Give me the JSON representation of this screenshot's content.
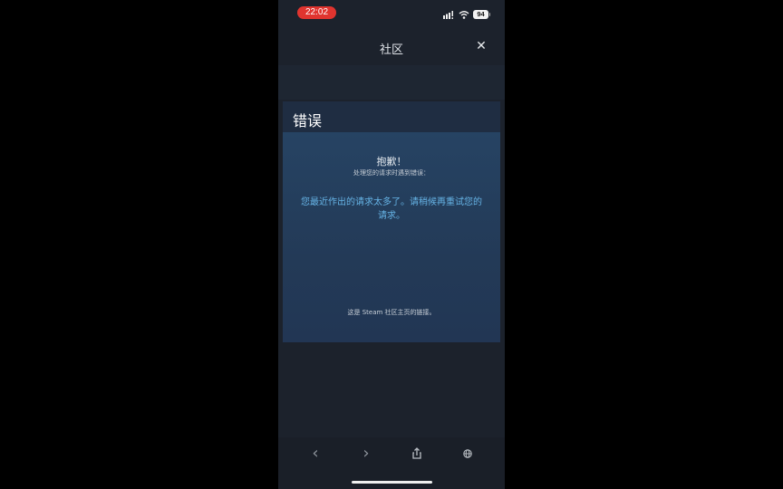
{
  "status_bar": {
    "time": "22:02",
    "battery": "94"
  },
  "nav": {
    "title": "社区",
    "close_symbol": "✕"
  },
  "error_page": {
    "title": "错误",
    "heading": "抱歉！",
    "subheading": "处理您的请求时遇到错误：",
    "message": "您最近作出的请求太多了。请稍候再重试您的请求。",
    "footer_text": "这是 Steam 社区主页的链接。"
  },
  "toolbar": {
    "back_symbol": "‹",
    "forward_symbol": "›",
    "share_icon": "share-icon",
    "browser_icon": "globe-icon"
  }
}
